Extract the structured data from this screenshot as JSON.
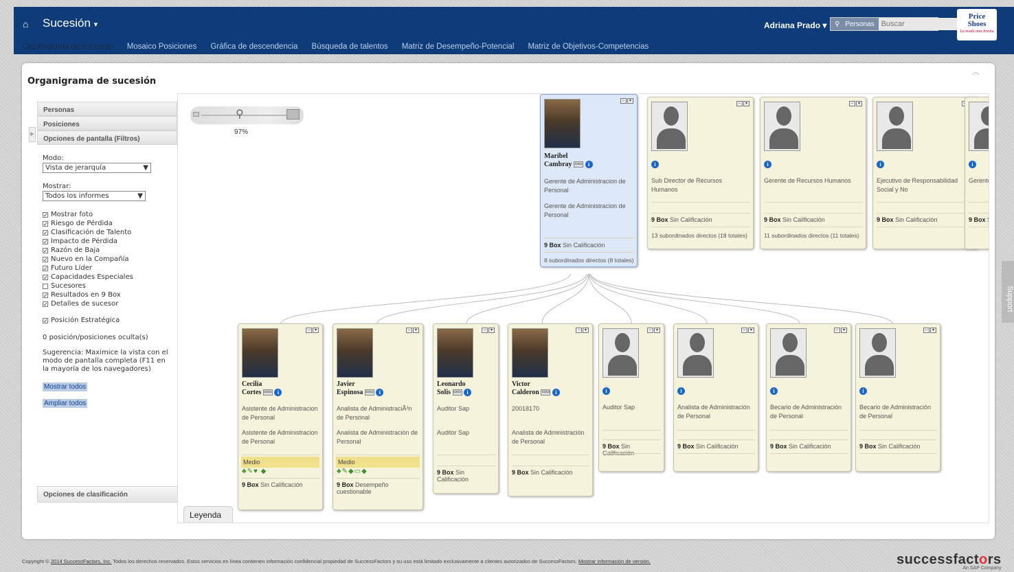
{
  "header": {
    "app_title": "Sucesión",
    "user_name": "Adriana Prado",
    "search_scope": "Personas",
    "search_placeholder": "Buscar",
    "brand_line1": "Price",
    "brand_line2": "Shoes",
    "brand_tagline": "La moda más bonita",
    "nav_tabs": [
      "Organigrama de sucesión",
      "Mosaico Posiciones",
      "Gráfica de descendencia",
      "Búsqueda de talentos",
      "Matriz de Desempeño-Potencial",
      "Matriz de Objetivos-Competencias"
    ],
    "active_tab": "Organigrama de sucesión"
  },
  "panel": {
    "title": "Organigrama de sucesión"
  },
  "sidebar": {
    "acc_people": "Personas",
    "acc_positions": "Posiciones",
    "acc_options": "Opciones de pantalla (Filtros)",
    "mode_label": "Modo:",
    "mode_value": "Vista de jerarquía",
    "show_label": "Mostrar:",
    "show_value": "Todos los informes",
    "checks": [
      {
        "label": "Mostrar foto",
        "checked": true
      },
      {
        "label": "Riesgo de Pérdida",
        "checked": true
      },
      {
        "label": "Clasificación de Talento",
        "checked": true
      },
      {
        "label": "Impacto de Pérdida",
        "checked": true
      },
      {
        "label": "Razón de Baja",
        "checked": true
      },
      {
        "label": "Nuevo en la Compañía",
        "checked": true
      },
      {
        "label": "Futuro Líder",
        "checked": true
      },
      {
        "label": "Capacidades Especiales",
        "checked": true
      },
      {
        "label": "Sucesores",
        "checked": false
      },
      {
        "label": "Resultados en 9 Box",
        "checked": true
      },
      {
        "label": "Detalles de sucesor",
        "checked": true
      }
    ],
    "strategic": "Posición Estratégica",
    "hidden_count": "0 posición/posiciones oculta(s)",
    "tip": "Sugerencia: Maximice la vista con el modo de pantalla completa (F11 en la mayoría de los navegadores)",
    "show_all": "Mostrar todos",
    "expand_all": "Ampliar todos",
    "classification": "Opciones de clasificación"
  },
  "canvas": {
    "zoom": "97%",
    "legend": "Leyenda"
  },
  "top_cards": [
    {
      "first": "Maribel",
      "last": "Cambray",
      "photo": true,
      "title": "Gerente de Administracion de Personal",
      "title2": "Gerente de Administracion de Personal",
      "nine_box": "9 Box",
      "rating": "Sin Calificación",
      "subs": "8 subordinados directos (8 totales)"
    },
    {
      "first": "",
      "last": "",
      "photo": false,
      "title": "Sub Director de Recursos Humanos",
      "nine_box": "9 Box",
      "rating": "Sin Calificación",
      "subs": "13 subordinados directos (18 totales)"
    },
    {
      "first": "",
      "last": "",
      "photo": false,
      "title": "Gerente de Recursos Humanos",
      "nine_box": "9 Box",
      "rating": "Sin Calificación",
      "subs": "11 subordinados directos (11 totales)"
    },
    {
      "first": "",
      "last": "",
      "photo": false,
      "title": "Ejecutivo de Responsabilidad Social y No",
      "nine_box": "9 Box",
      "rating": "Sin Calificación",
      "subs": ""
    },
    {
      "first": "",
      "last": "",
      "photo": false,
      "title": "Gerente",
      "nine_box": "9 Box",
      "rating": "S",
      "subs": ""
    }
  ],
  "bottom_cards": [
    {
      "first": "Cecilia",
      "last": "Cortes",
      "photo": true,
      "title": "Asistente de Administracion de Personal",
      "title2": "Asistente de Administracion de Personal",
      "medio": "Medio",
      "risk": "♣✎♥ ◆",
      "nine_box": "9 Box",
      "rating": "Sin Calificación"
    },
    {
      "first": "Javier",
      "last": "Espinosa",
      "photo": true,
      "title": "Analista de AdministraciÃ³n de Personal",
      "title2": "Analista de Administración de Personal",
      "medio": "Medio",
      "risk": "♣✎◆▭◆",
      "nine_box": "9 Box",
      "rating": "Desempeño cuestionable"
    },
    {
      "first": "Leonardo",
      "last": "Solis",
      "photo": true,
      "title": "Auditor Sap",
      "title2": "Auditor Sap",
      "medio": "",
      "risk": "",
      "nine_box": "9 Box",
      "rating": "Sin Calificación"
    },
    {
      "first": "Victor",
      "last": "Calderon",
      "photo": true,
      "title": "20018170",
      "title2": "Analista de Administración de Personal",
      "medio": "",
      "risk": "",
      "nine_box": "9 Box",
      "rating": "Sin Calificación"
    },
    {
      "first": "",
      "last": "",
      "photo": false,
      "title": "Auditor Sap",
      "title2": "",
      "medio": "",
      "risk": "",
      "nine_box": "9 Box",
      "rating": "Sin Calificación"
    },
    {
      "first": "",
      "last": "",
      "photo": false,
      "title": "Analista de Administración de Personal",
      "title2": "",
      "medio": "",
      "risk": "",
      "nine_box": "9 Box",
      "rating": "Sin Calificación"
    },
    {
      "first": "",
      "last": "",
      "photo": false,
      "title": "Becario de Administración de Personal",
      "title2": "",
      "medio": "",
      "risk": "",
      "nine_box": "9 Box",
      "rating": "Sin Calificación"
    },
    {
      "first": "",
      "last": "",
      "photo": false,
      "title": "Becario de Administración de Personal",
      "title2": "",
      "medio": "",
      "risk": "",
      "nine_box": "9 Box",
      "rating": "Sin Calificación"
    }
  ],
  "support": "Support",
  "footer": {
    "pre": "Copyright ©",
    "company": "2014 SuccessFactors, Inc.",
    "text": "Todos los derechos reservados. Estos servicios en línea contienen información confidencial propiedad de SuccessFactors y su uso está limitado exclusivamente a clientes autorizados de SuccessFactors.",
    "version_link": "Mostrar información de versión.",
    "brand_a": "successfact",
    "brand_o": "o",
    "brand_b": "rs",
    "brand_sub": "An SAP Company"
  }
}
